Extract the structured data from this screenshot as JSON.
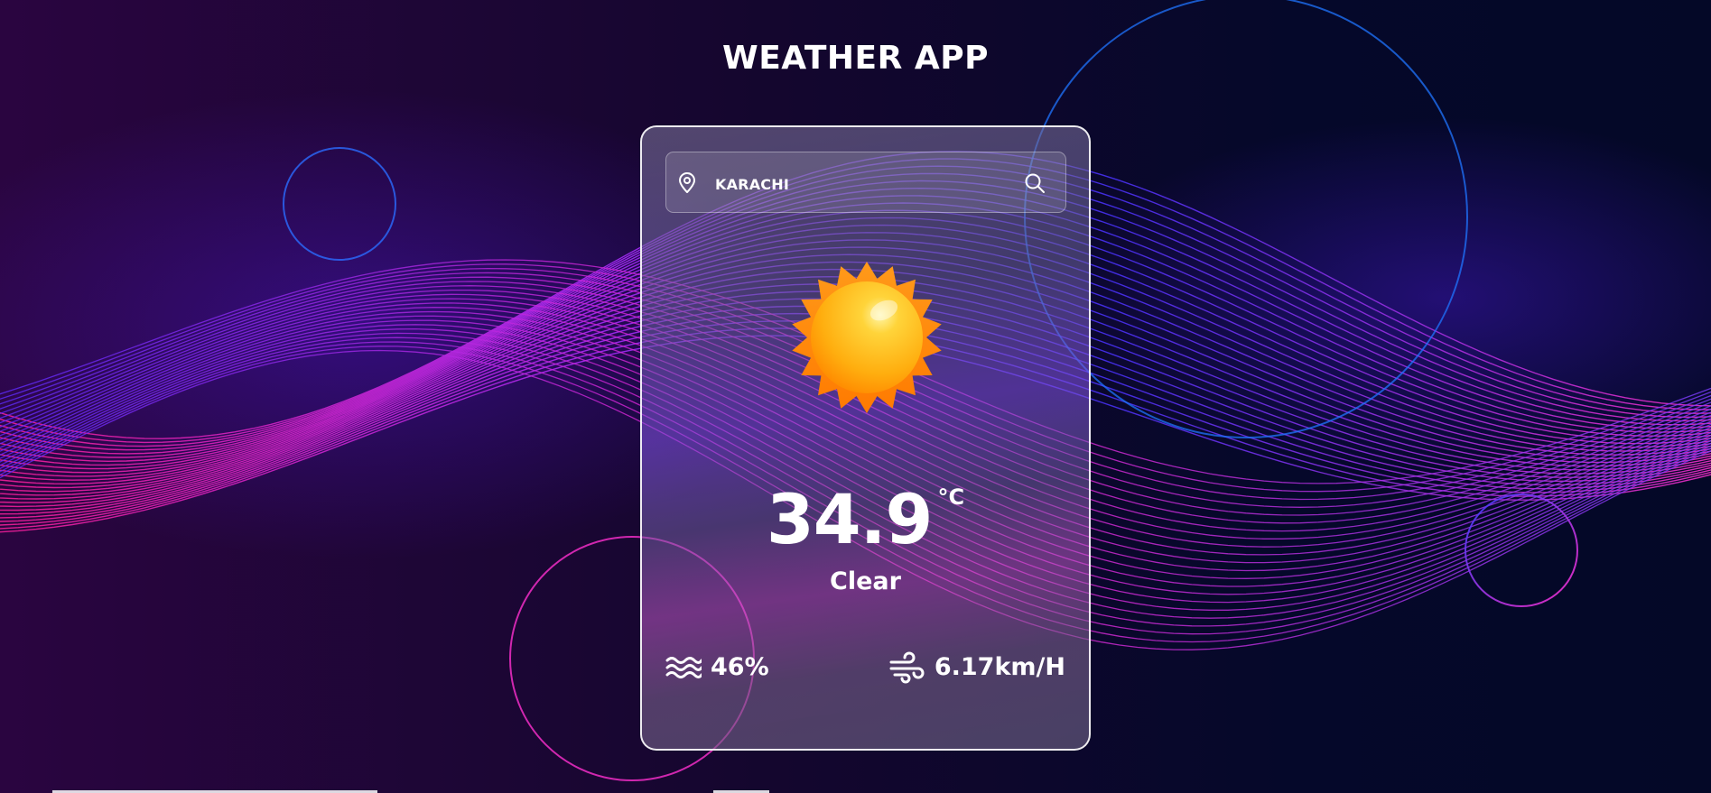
{
  "app": {
    "title": "WEATHER APP"
  },
  "search": {
    "city_value": "KARACHI",
    "location_icon": "map-pin-icon",
    "search_icon": "magnifier-icon"
  },
  "weather": {
    "icon": "sun-icon",
    "temperature": "34.9",
    "unit": "°C",
    "condition": "Clear"
  },
  "stats": {
    "humidity": {
      "icon": "waves-icon",
      "value": "46%"
    },
    "wind": {
      "icon": "wind-icon",
      "value": "6.17km/H"
    }
  },
  "colors": {
    "accent_pink": "#ff2fd0",
    "accent_blue": "#2a6bff",
    "accent_purple": "#8a3cff",
    "sun_orange": "#ff8a00",
    "sun_yellow": "#ffc21a"
  }
}
